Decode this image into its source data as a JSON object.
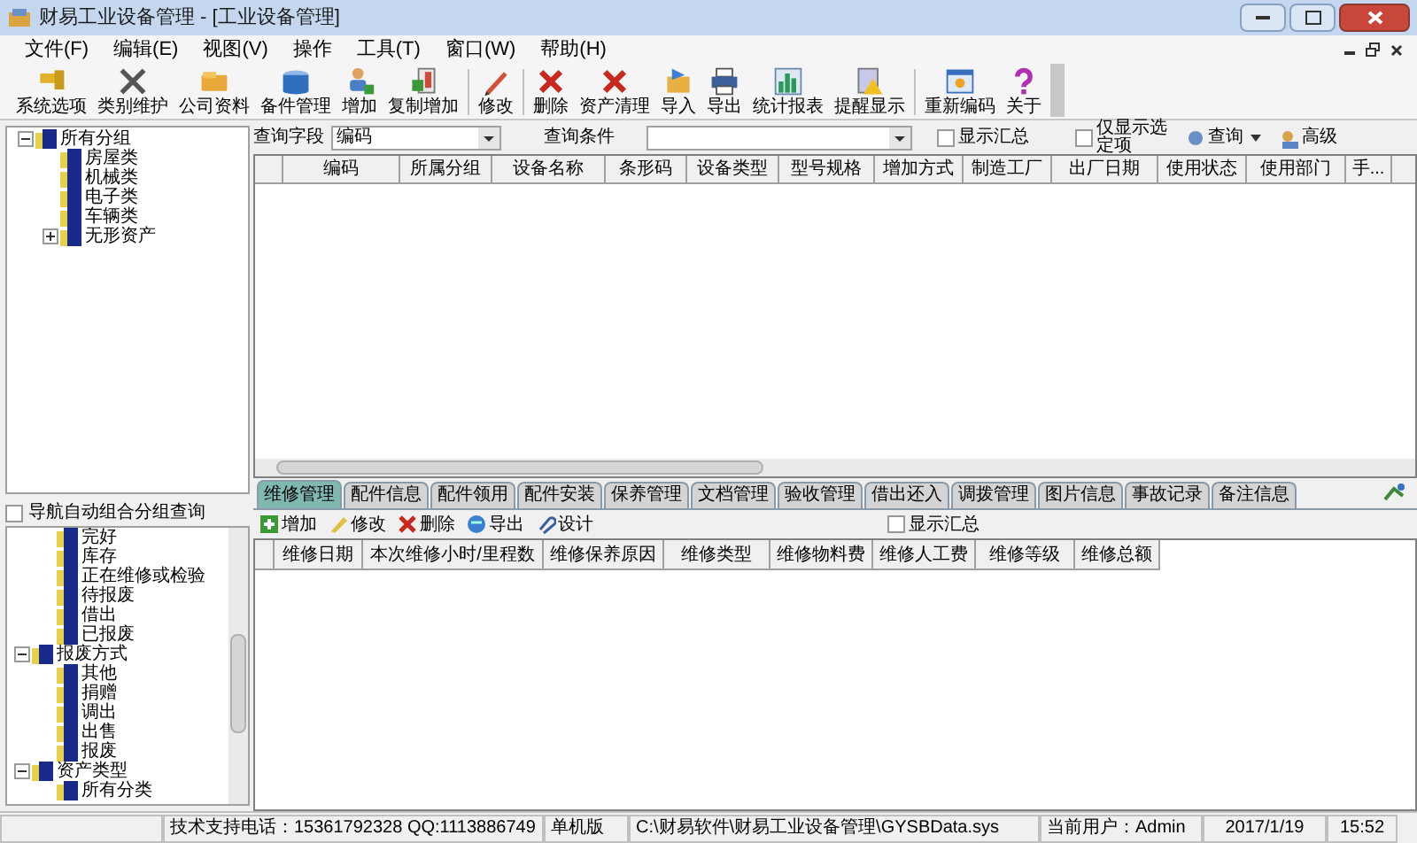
{
  "window": {
    "title": "财易工业设备管理 - [工业设备管理]"
  },
  "menu": [
    "文件(F)",
    "编辑(E)",
    "视图(V)",
    "操作",
    "工具(T)",
    "窗口(W)",
    "帮助(H)"
  ],
  "toolbar": [
    "系统选项",
    "类别维护",
    "公司资料",
    "备件管理",
    "增加",
    "复制增加",
    "修改",
    "删除",
    "资产清理",
    "导入",
    "导出",
    "统计报表",
    "提醒显示",
    "重新编码",
    "关于"
  ],
  "category_tree": [
    {
      "label": "所有分组",
      "expanded": true,
      "children": [
        {
          "label": "房屋类"
        },
        {
          "label": "机械类"
        },
        {
          "label": "电子类"
        },
        {
          "label": "车辆类"
        },
        {
          "label": "无形资产",
          "expanded": false
        }
      ]
    }
  ],
  "nav_auto_group": {
    "label": "导航自动组合分组查询",
    "checked": false
  },
  "nav_tree": [
    {
      "children": [
        {
          "label": "完好"
        },
        {
          "label": "库存"
        },
        {
          "label": "正在维修或检验"
        },
        {
          "label": "待报废"
        },
        {
          "label": "借出"
        },
        {
          "label": "已报废"
        }
      ]
    },
    {
      "label": "报废方式",
      "expanded": true,
      "children": [
        {
          "label": "其他"
        },
        {
          "label": "捐赠"
        },
        {
          "label": "调出"
        },
        {
          "label": "出售"
        },
        {
          "label": "报废"
        }
      ]
    },
    {
      "label": "资产类型",
      "expanded": true,
      "children": [
        {
          "label": "所有分类"
        }
      ]
    }
  ],
  "query": {
    "field_label": "查询字段",
    "field_value": "编码",
    "condition_label": "查询条件",
    "show_total": {
      "label": "显示汇总",
      "checked": false
    },
    "only_selected": {
      "label": "仅显示选定项",
      "checked": false
    },
    "query_button": "查询",
    "advanced_button": "高级"
  },
  "table": {
    "columns": [
      "编码",
      "所属分组",
      "设备名称",
      "条形码",
      "设备类型",
      "型号规格",
      "增加方式",
      "制造工厂",
      "出厂日期",
      "使用状态",
      "使用部门",
      "手..."
    ]
  },
  "tabs": [
    {
      "label": "维修管理",
      "selected": true
    },
    {
      "label": "配件信息",
      "selected": false
    },
    {
      "label": "配件领用",
      "selected": false
    },
    {
      "label": "配件安装",
      "selected": false
    },
    {
      "label": "保养管理",
      "selected": false
    },
    {
      "label": "文档管理",
      "selected": false
    },
    {
      "label": "验收管理",
      "selected": false
    },
    {
      "label": "借出还入",
      "selected": false
    },
    {
      "label": "调拨管理",
      "selected": false
    },
    {
      "label": "图片信息",
      "selected": false
    },
    {
      "label": "事故记录",
      "selected": false
    },
    {
      "label": "备注信息",
      "selected": false
    }
  ],
  "sub_toolbar": [
    "增加",
    "修改",
    "删除",
    "导出",
    "设计"
  ],
  "sub_show_total": {
    "label": "显示汇总",
    "checked": false
  },
  "sub_table": {
    "columns": [
      "维修日期",
      "本次维修小时/里程数",
      "维修保养原因",
      "维修类型",
      "维修物料费",
      "维修人工费",
      "维修等级",
      "维修总额"
    ]
  },
  "status_bar": [
    "技术支持电话：15361792328 QQ:1113886749",
    "单机版",
    "C:\\财易软件\\财易工业设备管理\\GYSBData.sys",
    "当前用户：Admin",
    "2017/1/19",
    "15:52"
  ]
}
